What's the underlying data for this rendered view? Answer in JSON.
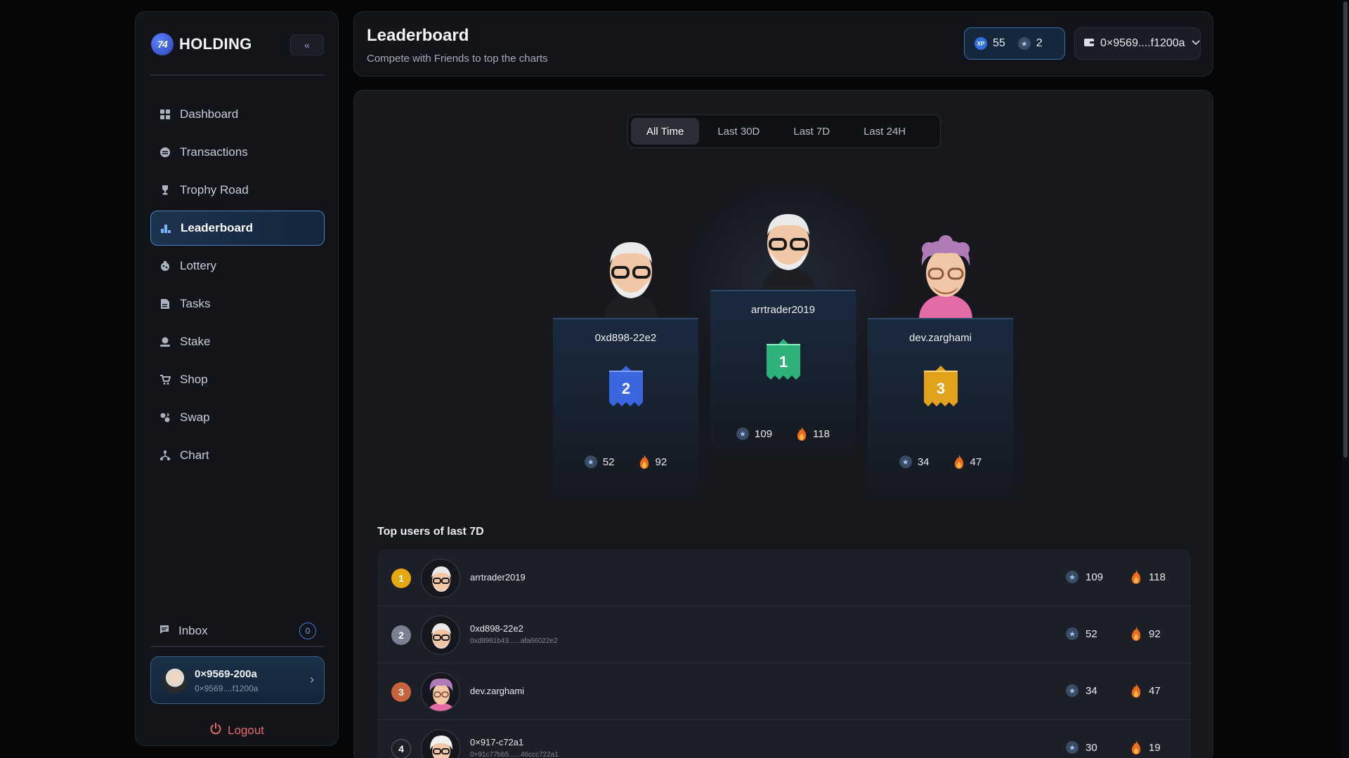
{
  "brand": {
    "name": "HOLDING",
    "logo_text": "74"
  },
  "sidebar": {
    "items": [
      {
        "label": "Dashboard",
        "icon": "grid-icon"
      },
      {
        "label": "Transactions",
        "icon": "coin-icon"
      },
      {
        "label": "Trophy Road",
        "icon": "trophy-icon"
      },
      {
        "label": "Leaderboard",
        "icon": "bars-icon",
        "active": true
      },
      {
        "label": "Lottery",
        "icon": "lottery-icon"
      },
      {
        "label": "Tasks",
        "icon": "document-icon"
      },
      {
        "label": "Stake",
        "icon": "stake-icon"
      },
      {
        "label": "Shop",
        "icon": "cart-icon"
      },
      {
        "label": "Swap",
        "icon": "swap-icon"
      },
      {
        "label": "Chart",
        "icon": "chart-icon"
      }
    ],
    "inbox": {
      "label": "Inbox",
      "count": "0"
    },
    "account": {
      "name": "0×9569-200a",
      "address": "0×9569....f1200a"
    },
    "logout_label": "Logout"
  },
  "header": {
    "title": "Leaderboard",
    "subtitle": "Compete with Friends to top the charts",
    "xp": "55",
    "stars": "2",
    "xp_label": "XP",
    "wallet": "0×9569....f1200a"
  },
  "tabs": [
    "All Time",
    "Last 30D",
    "Last 7D",
    "Last 24H"
  ],
  "podium": {
    "first": {
      "name": "arrtrader2019",
      "rank": "1",
      "stars": "109",
      "streak": "118",
      "color": "#2fb27a"
    },
    "second": {
      "name": "0xd898-22e2",
      "rank": "2",
      "stars": "52",
      "streak": "92",
      "color": "#3a66e0"
    },
    "third": {
      "name": "dev.zarghami",
      "rank": "3",
      "stars": "34",
      "streak": "47",
      "color": "#e3a21c"
    }
  },
  "list": {
    "title": "Top users of last 7D",
    "rows": [
      {
        "rank": "1",
        "name": "arrtrader2019",
        "address": "",
        "stars": "109",
        "streak": "118",
        "rank_color": "#e5a90f"
      },
      {
        "rank": "2",
        "name": "0xd898-22e2",
        "address": "0xd8981b43......afa66022e2",
        "stars": "52",
        "streak": "92",
        "rank_color": "#7b8190"
      },
      {
        "rank": "3",
        "name": "dev.zarghami",
        "address": "",
        "stars": "34",
        "streak": "47",
        "rank_color": "#c9623e"
      },
      {
        "rank": "4",
        "name": "0×917-c72a1",
        "address": "0×91c77bb5......46ccc722a1",
        "stars": "30",
        "streak": "19",
        "rank_color": "#1c1f26"
      }
    ]
  }
}
